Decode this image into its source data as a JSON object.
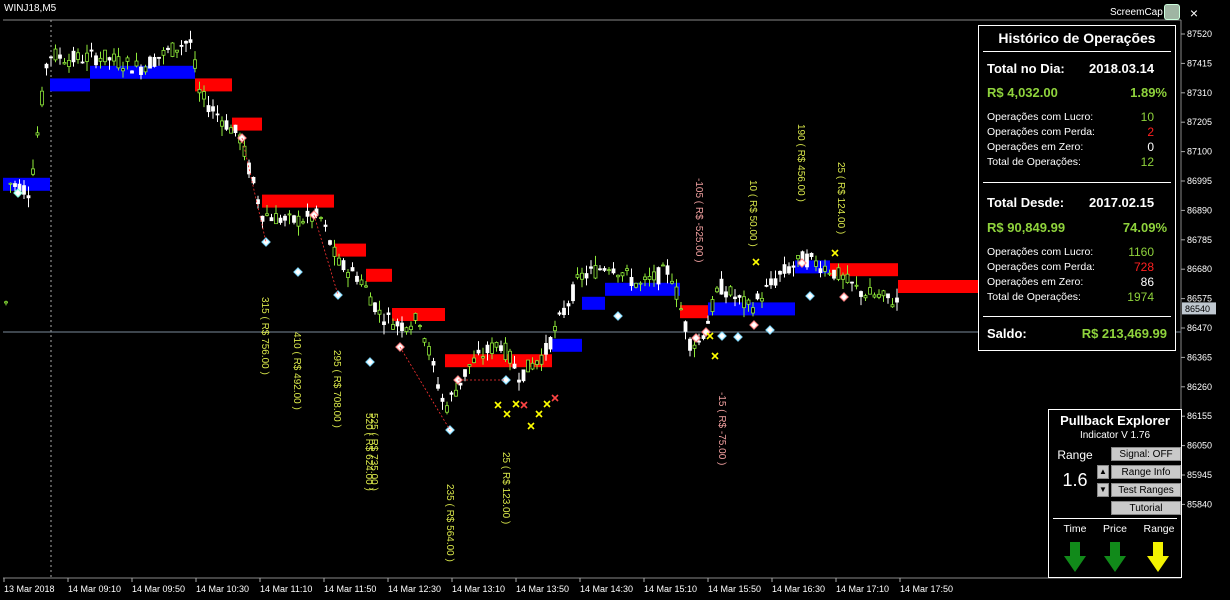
{
  "header": {
    "symbol": "WINJ18,M5",
    "screencap_label": "ScreemCap",
    "close_glyph": "×"
  },
  "axis": {
    "price_ticks": [
      "87520",
      "87415",
      "87310",
      "87205",
      "87100",
      "86995",
      "86890",
      "86785",
      "86680",
      "86575",
      "86470",
      "86365",
      "86260",
      "86155",
      "86050",
      "85945",
      "85840"
    ],
    "current_price": "86540",
    "time_ticks": [
      "13 Mar 2018",
      "14 Mar 09:10",
      "14 Mar 09:50",
      "14 Mar 10:30",
      "14 Mar 11:10",
      "14 Mar 11:50",
      "14 Mar 12:30",
      "14 Mar 13:10",
      "14 Mar 13:50",
      "14 Mar 14:30",
      "14 Mar 15:10",
      "14 Mar 15:50",
      "14 Mar 16:30",
      "14 Mar 17:10",
      "14 Mar 17:50"
    ]
  },
  "trade_labels": [
    {
      "text": "315 ( R$ 756.00 )",
      "color": "#d8e64a"
    },
    {
      "text": "410 ( R$ 492.00 )",
      "color": "#d8e64a"
    },
    {
      "text": "295 ( R$ 708.00 )",
      "color": "#d8e64a"
    },
    {
      "text": "525 ( R$ 735.00 )",
      "color": "#d8e64a"
    },
    {
      "text": "520 ( R$ 624.00 )",
      "color": "#d8e64a"
    },
    {
      "text": "235 ( R$ 564.00 )",
      "color": "#d8e64a"
    },
    {
      "text": "25 ( R$ 123.00 )",
      "color": "#d8e64a"
    },
    {
      "text": "-105 ( R$ -525.00 )",
      "color": "#f2a0a0"
    },
    {
      "text": "-15 ( R$ -75.00 )",
      "color": "#f2a0a0"
    },
    {
      "text": "10 ( R$ 50.00 )",
      "color": "#d8e64a"
    },
    {
      "text": "190 ( R$ 456.00 )",
      "color": "#d8e64a"
    },
    {
      "text": "25 ( R$ 124.00 )",
      "color": "#d8e64a"
    }
  ],
  "history": {
    "title": "Histórico de Operações",
    "day_label": "Total no Dia:",
    "day_date": "2018.03.14",
    "day_amount": "R$ 4,032.00",
    "day_percent": "1.89%",
    "day_rows": [
      {
        "label": "Operações com Lucro:",
        "value": "10"
      },
      {
        "label": "Operações com Perda:",
        "value": "2"
      },
      {
        "label": "Operações em Zero:",
        "value": "0"
      },
      {
        "label": "Total de Operações:",
        "value": "12"
      }
    ],
    "since_label": "Total Desde:",
    "since_date": "2017.02.15",
    "since_amount": "R$ 90,849.99",
    "since_percent": "74.09%",
    "since_rows": [
      {
        "label": "Operações com Lucro:",
        "value": "1160"
      },
      {
        "label": "Operações com Perda:",
        "value": "728"
      },
      {
        "label": "Operações em Zero:",
        "value": "86"
      },
      {
        "label": "Total de Operações:",
        "value": "1974"
      }
    ],
    "saldo_label": "Saldo:",
    "saldo_value": "R$ 213,469.99"
  },
  "pullback": {
    "title": "Pullback Explorer",
    "version": "Indicator V 1.76",
    "range_label": "Range",
    "range_value": "1.6",
    "signal_btn": "Signal: OFF",
    "range_info_btn": "Range Info",
    "test_ranges_btn": "Test Ranges",
    "tutorial_btn": "Tutorial",
    "indicators": [
      {
        "label": "Time",
        "direction": "down",
        "color": "#118a1a"
      },
      {
        "label": "Price",
        "direction": "down",
        "color": "#118a1a"
      },
      {
        "label": "Range",
        "direction": "down",
        "color": "#f2f200"
      }
    ]
  },
  "colors": {
    "bull_candle": "#8fea3a",
    "bear_candle": "#ffffff",
    "band_up": "#0000ff",
    "band_down": "#ff0000",
    "panel_green": "#8fd33c"
  }
}
